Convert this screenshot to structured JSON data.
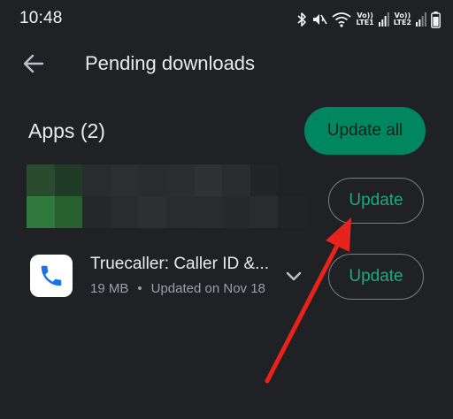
{
  "status_bar": {
    "time": "10:48",
    "sim1_label_top": "Vo))",
    "sim1_label_bottom": "LTE1",
    "sim2_label_top": "Vo))",
    "sim2_label_bottom": "LTE2",
    "icons": [
      "bluetooth-icon",
      "mute-icon",
      "wifi-icon",
      "signal-icon",
      "signal-icon",
      "battery-icon"
    ]
  },
  "header": {
    "title": "Pending downloads"
  },
  "apps_section": {
    "title": "Apps (2)",
    "update_all_label": "Update all"
  },
  "app_rows": [
    {
      "name": "",
      "update_label": "Update",
      "obscured": true
    },
    {
      "name": "Truecaller: Caller ID &...",
      "size": "19 MB",
      "separator": "•",
      "updated": "Updated on Nov 18",
      "update_label": "Update"
    }
  ],
  "colors": {
    "background": "#202124",
    "accent_green": "#01875f",
    "button_text_green": "#1ea97c",
    "annotation_red": "#e8221c"
  }
}
